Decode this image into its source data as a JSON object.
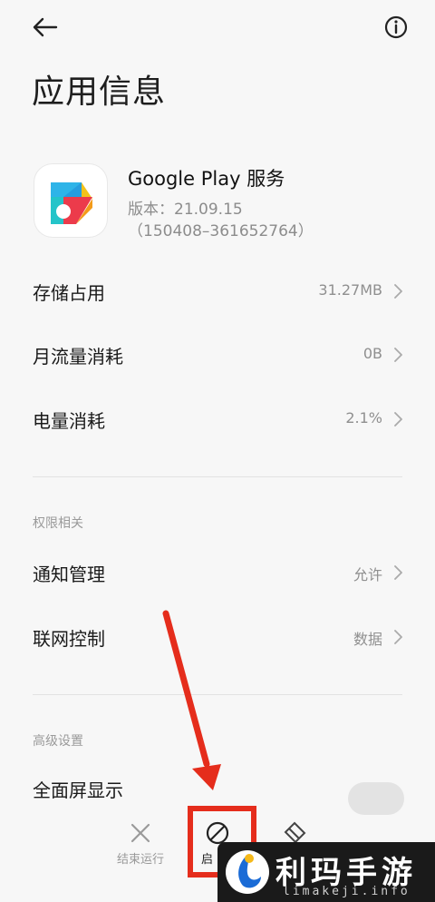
{
  "header": {
    "title": "应用信息"
  },
  "app": {
    "name": "Google Play 服务",
    "version": "版本：21.09.15",
    "build": "（150408–361652764）"
  },
  "rows": [
    {
      "label": "存储占用",
      "value": "31.27MB"
    },
    {
      "label": "月流量消耗",
      "value": "0B"
    },
    {
      "label": "电量消耗",
      "value": "2.1%"
    }
  ],
  "permissions": {
    "section_title": "权限相关",
    "items": [
      {
        "label": "通知管理",
        "value": "允许"
      },
      {
        "label": "联网控制",
        "value": "数据"
      }
    ]
  },
  "advanced": {
    "section_title": "高级设置",
    "fullscreen_label": "全面屏显示"
  },
  "bottom_bar": {
    "force_stop": "结束运行",
    "disable_partial": "启"
  },
  "watermark": {
    "text": "利玛手游",
    "url": "limakeji.info"
  },
  "colors": {
    "background": "#f7f7f7",
    "annotation": "#e52d1c",
    "secondary_text": "#8f8f8f"
  }
}
